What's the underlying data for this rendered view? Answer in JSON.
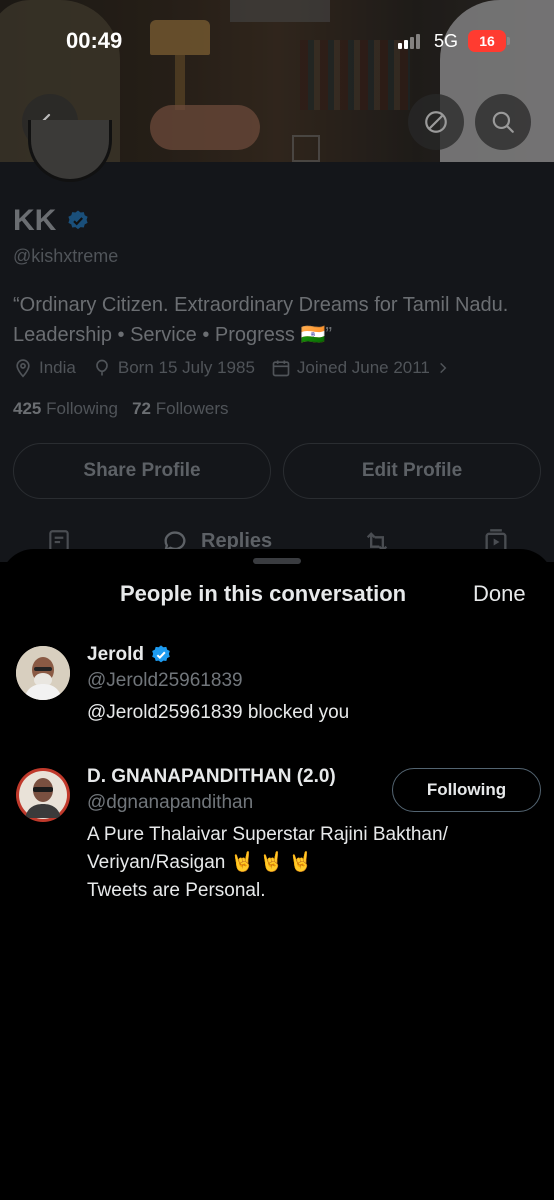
{
  "status_bar": {
    "time": "00:49",
    "network": "5G",
    "battery": "16"
  },
  "profile": {
    "name": "KK",
    "handle": "@kishxtreme",
    "bio_line1": "“Ordinary Citizen. Extraordinary Dreams for Tamil Nadu.",
    "bio_line2": "Leadership • Service • Progress 🇮🇳”",
    "location": "India",
    "born": "Born 15 July 1985",
    "joined": "Joined June 2011",
    "following_count": "425",
    "following_label": "Following",
    "followers_count": "72",
    "followers_label": "Followers",
    "share_button": "Share Profile",
    "edit_button": "Edit Profile",
    "tab_replies": "Replies"
  },
  "sheet": {
    "title": "People in this conversation",
    "done_label": "Done",
    "people": [
      {
        "name": "Jerold",
        "handle": "@Jerold25961839",
        "bio": "@Jerold25961839 blocked you",
        "verified": true
      },
      {
        "name": "D. GNANAPANDITHAN (2.0)",
        "handle": "@dgnanapandithan",
        "bio_line1": "A Pure Thalaivar Superstar Rajini Bakthan/",
        "bio_line2": "Veriyan/Rasigan 🤘 🤘 🤘",
        "bio_line3": "Tweets are Personal.",
        "follow_label": "Following"
      }
    ]
  },
  "colors": {
    "verified_blue": "#1d9bf0",
    "battery_red": "#ff3b30",
    "background": "#000000"
  },
  "icons": [
    "back-arrow-icon",
    "block-icon",
    "search-icon",
    "verified-badge-icon",
    "location-pin-icon",
    "balloon-icon",
    "calendar-icon",
    "chevron-right-icon"
  ]
}
